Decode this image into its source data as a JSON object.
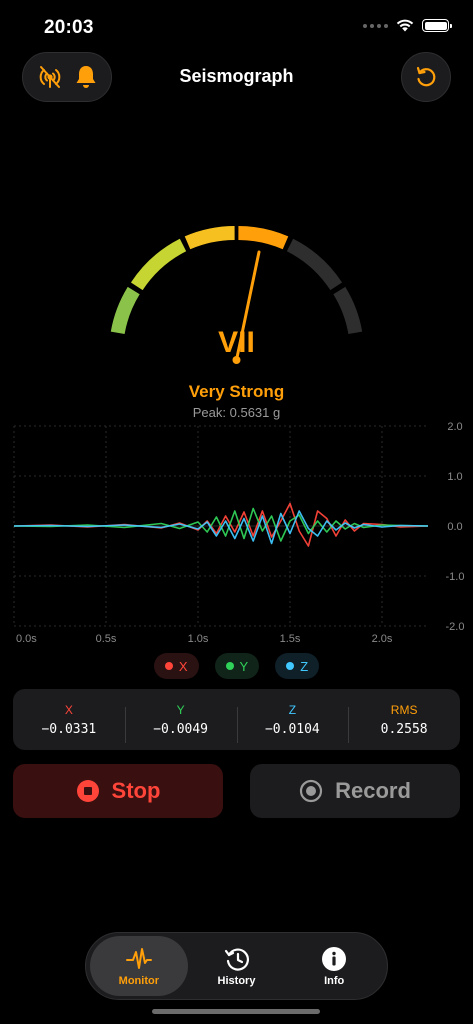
{
  "status": {
    "time": "20:03"
  },
  "nav": {
    "title": "Seismograph"
  },
  "gauge": {
    "level": "VII",
    "label": "Very Strong",
    "peak": "Peak: 0.5631 g"
  },
  "chart_data": {
    "type": "line",
    "x_ticks": [
      "0.0s",
      "0.5s",
      "1.0s",
      "1.5s",
      "2.0s"
    ],
    "y_ticks": [
      "2.0",
      "1.0",
      "0.0",
      "-1.0",
      "-2.0"
    ],
    "xlim": [
      0.0,
      2.25
    ],
    "ylim": [
      -2.0,
      2.0
    ],
    "grid": true,
    "series": [
      {
        "name": "X",
        "color": "#ff453a",
        "x": [
          0.0,
          0.2,
          0.4,
          0.6,
          0.8,
          0.9,
          1.0,
          1.05,
          1.1,
          1.15,
          1.2,
          1.25,
          1.3,
          1.35,
          1.4,
          1.45,
          1.5,
          1.55,
          1.6,
          1.65,
          1.7,
          1.75,
          1.8,
          1.85,
          1.9,
          2.0,
          2.1,
          2.25
        ],
        "y": [
          0.0,
          0.02,
          -0.02,
          0.03,
          -0.04,
          0.06,
          -0.08,
          0.1,
          -0.15,
          0.2,
          -0.12,
          0.28,
          -0.2,
          0.3,
          -0.22,
          0.1,
          0.45,
          -0.1,
          -0.4,
          0.3,
          0.15,
          -0.2,
          0.12,
          -0.1,
          0.05,
          0.03,
          -0.02,
          0.0
        ]
      },
      {
        "name": "Y",
        "color": "#30d158",
        "x": [
          0.0,
          0.2,
          0.4,
          0.6,
          0.8,
          0.9,
          1.0,
          1.05,
          1.1,
          1.15,
          1.2,
          1.25,
          1.3,
          1.35,
          1.4,
          1.45,
          1.5,
          1.55,
          1.6,
          1.65,
          1.7,
          1.75,
          1.8,
          1.85,
          1.9,
          2.0,
          2.1,
          2.25
        ],
        "y": [
          0.0,
          -0.01,
          0.02,
          -0.03,
          0.05,
          -0.05,
          0.08,
          -0.12,
          0.18,
          -0.2,
          0.3,
          -0.25,
          0.35,
          -0.1,
          0.2,
          -0.3,
          0.1,
          0.22,
          -0.15,
          0.1,
          -0.12,
          0.1,
          -0.06,
          0.05,
          -0.03,
          0.02,
          0.01,
          0.0
        ]
      },
      {
        "name": "Z",
        "color": "#40c8ff",
        "x": [
          0.0,
          0.2,
          0.4,
          0.6,
          0.8,
          0.9,
          1.0,
          1.05,
          1.1,
          1.15,
          1.2,
          1.25,
          1.3,
          1.35,
          1.4,
          1.45,
          1.5,
          1.55,
          1.6,
          1.65,
          1.7,
          1.75,
          1.8,
          1.85,
          1.9,
          2.0,
          2.1,
          2.25
        ],
        "y": [
          0.0,
          0.01,
          -0.01,
          0.02,
          -0.03,
          0.04,
          -0.06,
          0.08,
          -0.2,
          0.1,
          -0.25,
          0.15,
          -0.3,
          0.2,
          -0.35,
          0.25,
          -0.15,
          0.3,
          -0.05,
          -0.2,
          0.1,
          -0.08,
          0.06,
          -0.04,
          0.03,
          -0.02,
          0.01,
          0.0
        ]
      }
    ]
  },
  "legend": [
    {
      "label": "X",
      "color": "#ff453a",
      "bg": "#2a1212"
    },
    {
      "label": "Y",
      "color": "#30d158",
      "bg": "#11241a"
    },
    {
      "label": "Z",
      "color": "#40c8ff",
      "bg": "#0f2029"
    }
  ],
  "readout": [
    {
      "label": "X",
      "value": "−0.0331",
      "color": "#ff453a"
    },
    {
      "label": "Y",
      "value": "−0.0049",
      "color": "#30d158"
    },
    {
      "label": "Z",
      "value": "−0.0104",
      "color": "#40c8ff"
    },
    {
      "label": "RMS",
      "value": "0.2558",
      "color": "#ff9f0a"
    }
  ],
  "actions": {
    "stop_label": "Stop",
    "record_label": "Record"
  },
  "tabs": [
    {
      "label": "Monitor",
      "icon": "waveform-icon",
      "active": true
    },
    {
      "label": "History",
      "icon": "history-icon",
      "active": false
    },
    {
      "label": "Info",
      "icon": "info-icon",
      "active": false
    }
  ],
  "colors": {
    "accent": "#ff9f0a",
    "danger": "#ff453a"
  }
}
